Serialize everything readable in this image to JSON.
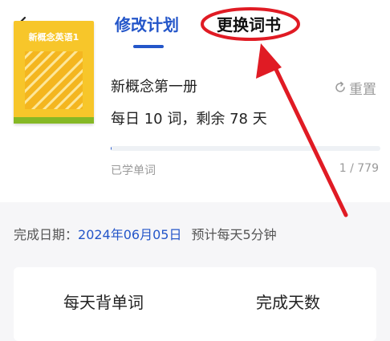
{
  "header": {
    "back_icon": "chevron-left-icon",
    "tabs": [
      {
        "label": "修改计划",
        "active": true
      },
      {
        "label": "更换词书",
        "active": false
      }
    ]
  },
  "book": {
    "cover_title": "新概念英语1",
    "name": "新概念第一册",
    "reset_label": "重置",
    "reset_icon": "refresh-icon",
    "plan_text": "每日 10 词，剩余 78 天",
    "learned_label": "已学单词",
    "progress_text": "1 / 779",
    "progress_fraction": 0.0013
  },
  "completion": {
    "label": "完成日期：",
    "date": "2024年06月05日",
    "estimate": "预计每天5分钟"
  },
  "options": {
    "left_header": "每天背单词",
    "right_header": "完成天数"
  },
  "colors": {
    "accent": "#2456c9",
    "annotation": "#e01b24",
    "cover": "#f7c62a",
    "cover_spine": "#86b825"
  }
}
